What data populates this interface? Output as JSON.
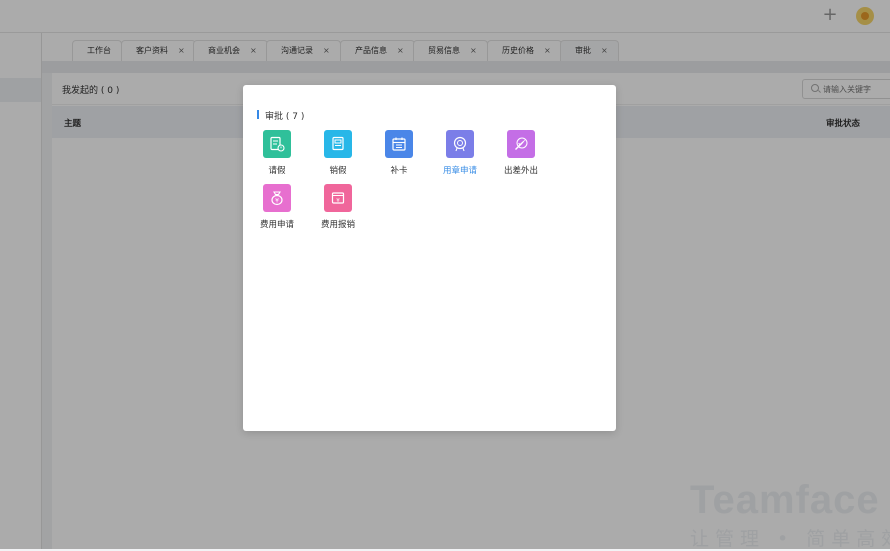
{
  "header": {
    "add_icon": "plus-icon",
    "avatar_icon": "user-avatar"
  },
  "tabs": [
    {
      "label": "工作台",
      "closable": false
    },
    {
      "label": "客户资料",
      "closable": true
    },
    {
      "label": "商业机会",
      "closable": true
    },
    {
      "label": "沟通记录",
      "closable": true
    },
    {
      "label": "产品信息",
      "closable": true
    },
    {
      "label": "贸易信息",
      "closable": true
    },
    {
      "label": "历史价格",
      "closable": true
    },
    {
      "label": "审批",
      "closable": true,
      "active": true
    }
  ],
  "tab_close_glyph": "×",
  "content": {
    "title": "我发起的 ( 0 )",
    "search_placeholder": "请输入关键字",
    "columns": {
      "subject": "主题",
      "status": "审批状态"
    }
  },
  "watermark": {
    "brand": "Teamface",
    "slogan": "让管理 • 简单高效"
  },
  "dialog": {
    "title": "审批 ( 7 )",
    "accent": "#3689e6",
    "apps": [
      {
        "label": "请假",
        "icon": "leave-form-icon",
        "color": "#2fc09a"
      },
      {
        "label": "销假",
        "icon": "leave-cancel-icon",
        "color": "#28b7e8"
      },
      {
        "label": "补卡",
        "icon": "calendar-icon",
        "color": "#4a86e8"
      },
      {
        "label": "用章申请",
        "icon": "seal-icon",
        "color": "#7b7ee8",
        "highlighted": true
      },
      {
        "label": "出差外出",
        "icon": "plane-icon",
        "color": "#c46ee6"
      },
      {
        "label": "费用申请",
        "icon": "money-bag-icon",
        "color": "#e76fcf"
      },
      {
        "label": "费用报销",
        "icon": "reimburse-icon",
        "color": "#f0669b"
      }
    ]
  }
}
